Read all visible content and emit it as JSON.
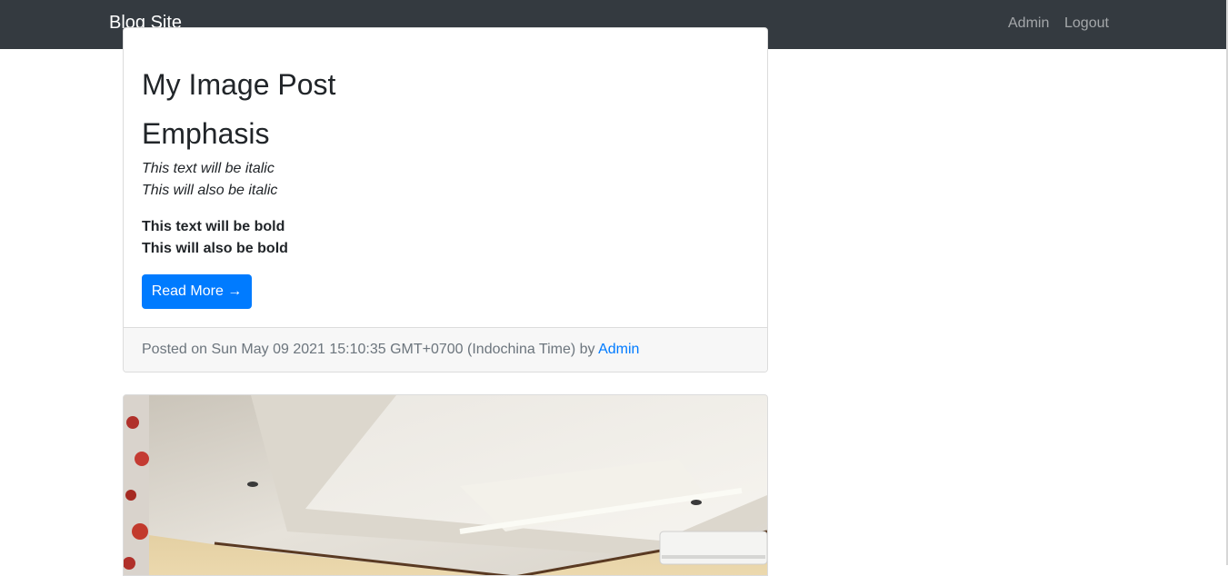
{
  "navbar": {
    "brand": "Blog Site",
    "links": [
      "Admin",
      "Logout"
    ]
  },
  "post": {
    "title": "My Image Post",
    "heading": "Emphasis",
    "italic_lines": [
      "This text will be italic",
      "This will also be italic"
    ],
    "bold_lines": [
      "This text will be bold",
      "This will also be bold"
    ],
    "read_more_label": "Read More →",
    "footer": {
      "prefix": "Posted on Sun May 09 2021 15:10:35 GMT+0700 (Indochina Time) by ",
      "author": "Admin"
    }
  },
  "colors": {
    "navbar_bg": "#343a40",
    "primary": "#007bff",
    "footer_bg": "#f7f7f7",
    "muted": "#6c757d"
  }
}
